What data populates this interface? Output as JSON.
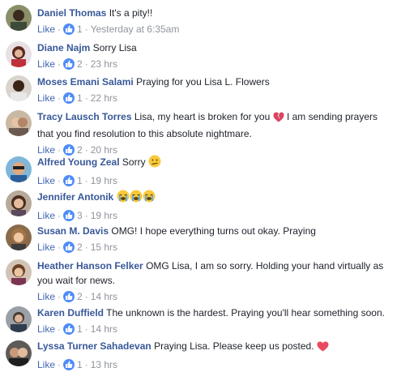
{
  "comments": [
    {
      "name": "Daniel Thomas",
      "text": "It's a pity!!",
      "like_label": "Like",
      "likes": "1",
      "time": "Yesterday at 6:35am"
    },
    {
      "name": "Diane Najm",
      "text": "Sorry Lisa",
      "like_label": "Like",
      "likes": "2",
      "time": "23 hrs"
    },
    {
      "name": "Moses Emani Salami",
      "text": "Praying for you Lisa L. Flowers",
      "like_label": "Like",
      "likes": "1",
      "time": "22 hrs"
    },
    {
      "name": "Tracy Lausch Torres",
      "text": "Lisa, my heart is broken for you",
      "text2": "I am sending prayers that you find resolution to this absolute nightmare.",
      "like_label": "Like",
      "likes": "2",
      "time": "20 hrs"
    },
    {
      "name": "Alfred Young Zeal",
      "text": "Sorry",
      "like_label": "Like",
      "likes": "1",
      "time": "19 hrs"
    },
    {
      "name": "Jennifer Antonik",
      "text": "",
      "like_label": "Like",
      "likes": "3",
      "time": "19 hrs"
    },
    {
      "name": "Susan M. Davis",
      "text": "OMG! I hope everything turns out okay. Praying",
      "like_label": "Like",
      "likes": "2",
      "time": "15 hrs"
    },
    {
      "name": "Heather Hanson Felker",
      "text": "OMG Lisa, I am so sorry. Holding your hand virtually as you wait for news.",
      "like_label": "Like",
      "likes": "2",
      "time": "14 hrs"
    },
    {
      "name": "Karen Duffield",
      "text": "The unknown is the hardest. Praying you'll hear something soon.",
      "like_label": "Like",
      "likes": "1",
      "time": "14 hrs"
    },
    {
      "name": "Lyssa Turner Sahadevan",
      "text": "Praying Lisa. Please keep us posted.",
      "like_label": "Like",
      "likes": "1",
      "time": "13 hrs"
    }
  ],
  "separator": "·",
  "icons": {
    "like": "thumbs-up-icon",
    "broken_heart": "broken-heart-emoji",
    "confused": "confused-face-emoji",
    "crying": "crying-face-emoji",
    "heart": "red-heart-emoji"
  },
  "colors": {
    "name": "#385898",
    "link": "#4267b2",
    "meta": "#90949c",
    "like_badge": "#4f8cf7"
  }
}
